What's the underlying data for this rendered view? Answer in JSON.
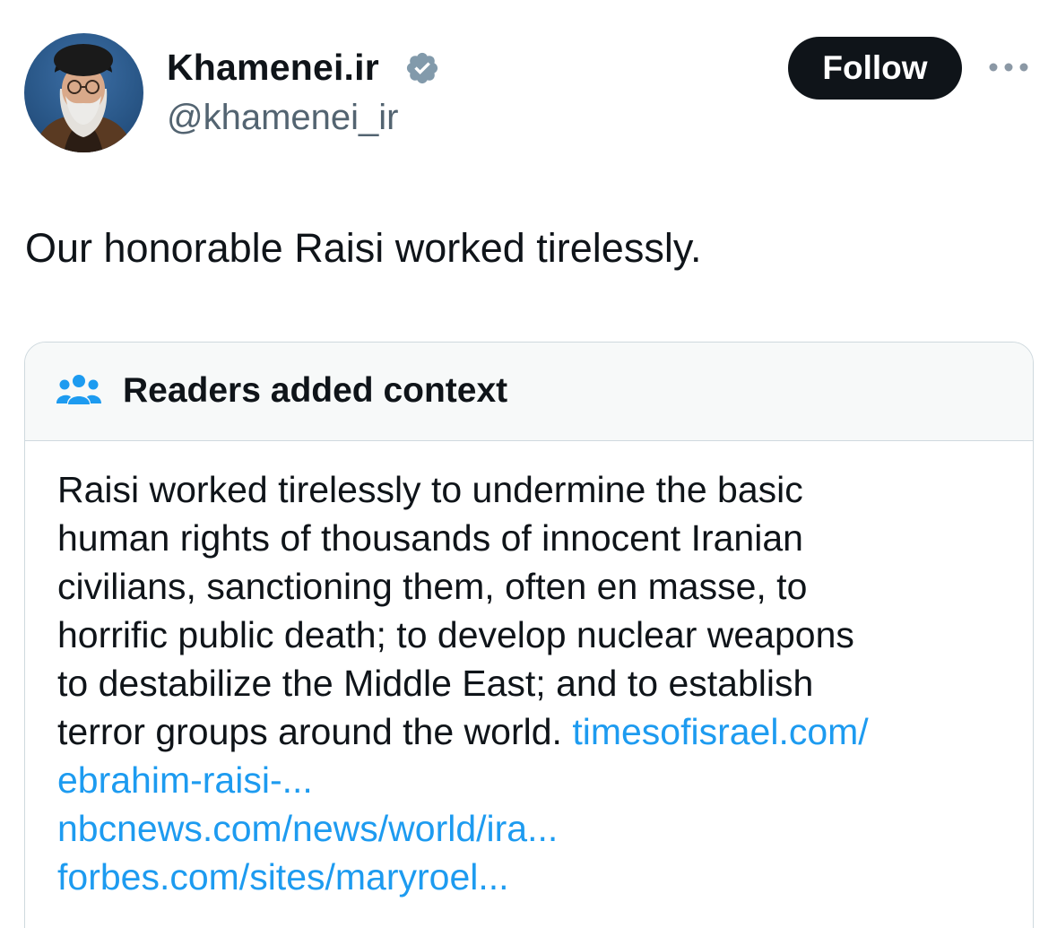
{
  "author": {
    "display_name": "Khamenei.ir",
    "handle": "@khamenei_ir",
    "verified": true,
    "verified_color": "#829aab"
  },
  "actions": {
    "follow_label": "Follow",
    "more_icon": "more-horizontal-icon"
  },
  "tweet": {
    "text": "Our honorable Raisi worked tirelessly."
  },
  "community_note": {
    "header_icon": "people-icon",
    "header_icon_color": "#1d9bf0",
    "title": "Readers added context",
    "body_lines": [
      "Raisi worked tirelessly to undermine the basic",
      "human rights of thousands of innocent Iranian",
      "civilians, sanctioning them, often en masse, to",
      "horrific public death; to develop nuclear weapons",
      "to destabilize the Middle East; and to establish",
      "terror groups around the world."
    ],
    "links": [
      "timesofisrael.com/",
      "ebrahim-raisi-...",
      "nbcnews.com/news/world/ira...",
      "forbes.com/sites/maryroel..."
    ]
  },
  "colors": {
    "text_primary": "#0f1419",
    "text_secondary": "#536471",
    "link": "#1d9bf0",
    "border": "#cfd9de",
    "note_header_bg": "#f7f9f9"
  }
}
